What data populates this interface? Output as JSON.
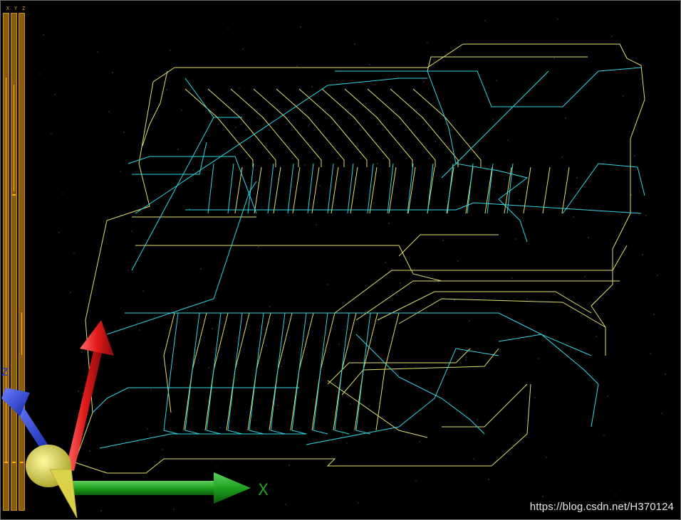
{
  "viewport": {
    "axis_labels": [
      "X",
      "Y",
      "Z"
    ],
    "bar_accent": "#ffb000",
    "trace_colors": {
      "top_layer": "#e0e070",
      "bottom_layer": "#33d9e6"
    },
    "gizmo": {
      "x_label": "X",
      "z_label": "Z",
      "colors": {
        "x": "#1fa21f",
        "y": "#e11b1b",
        "z": "#1b35e0",
        "hub": "#d9d24a"
      }
    },
    "watermark": "https://blog.csdn.net/H370124"
  }
}
